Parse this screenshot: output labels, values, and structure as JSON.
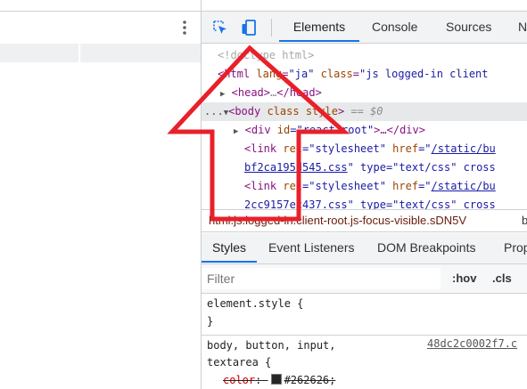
{
  "toolbar": {
    "inspect_icon": "inspect-cursor-icon",
    "device_icon": "device-toolbar-icon",
    "kebab_icon": "vertical-dots-icon",
    "tabs": [
      "Elements",
      "Console",
      "Sources",
      "N"
    ]
  },
  "dom": {
    "doctype": "<!doctype html>",
    "html_open": "html",
    "html_lang_attr": "lang",
    "html_lang_val": "\"ja\"",
    "html_class_attr": "class",
    "html_class_val": "\"js logged-in client",
    "head_open": "<head>",
    "head_dots": "…",
    "head_close": "</head>",
    "body_dots": "...",
    "body_open": "<body",
    "body_class_attr": " class",
    "body_class_val": " style",
    "body_close": ">",
    "body_eq": " == $0",
    "div_open": "<div",
    "div_id_attr": " id",
    "div_id_val": "=\"react-root\"",
    "div_end": ">…</div>",
    "link1_open": "<link",
    "link1_rel_attr": " rel",
    "link1_rel_val": "=\"stylesheet\"",
    "link1_href_attr": " href",
    "link1_href_val": "=\"",
    "link1_href_link": "/static/bu",
    "link1_cont_link": "bf2ca195d545.css",
    "link1_cont_rest": "\" type=\"text/css\" cross",
    "link2_open": "<link",
    "link2_rel_attr": " rel",
    "link2_rel_val": "=\"stylesheet\"",
    "link2_href_attr": " href",
    "link2_href_val": "=\"",
    "link2_href_link": "/static/bu",
    "link2_cont_link": "2cc9157ec437.css",
    "link2_cont_rest": "\" type=\"text/css\" cross"
  },
  "breadcrumb": {
    "text": "html.js.logged-in.client-root.js-focus-visible.sDN5V",
    "next": "b"
  },
  "styles_tabs": [
    "Styles",
    "Event Listeners",
    "DOM Breakpoints",
    "Prop"
  ],
  "filter": {
    "placeholder": "Filter",
    "hov": ":hov",
    "cls": ".cls"
  },
  "rules": {
    "element_style": "element.style {",
    "close1": "}",
    "selector": "body, button, input,",
    "selector2": "textarea {",
    "source": "48dc2c0002f7.c",
    "prop_name": "color",
    "prop_colon": ": ",
    "prop_value": "#262626;",
    "swatch_color": "#262626"
  },
  "colors": {
    "accent": "#1a73e8",
    "arrow": "#e8202a"
  }
}
